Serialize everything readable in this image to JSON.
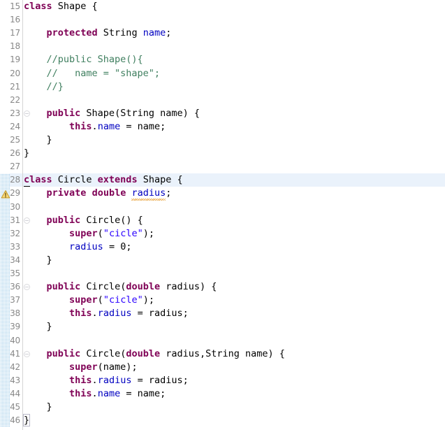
{
  "editor": {
    "app": "eclipse-java-editor",
    "language": "Java",
    "first_line_number": 15,
    "last_line_number": 46,
    "line_height_px": 19.1,
    "current_line_number": 28,
    "colors": {
      "background": "#ffffff",
      "keyword": "#7f0055",
      "string": "#2a00ff",
      "comment": "#3f7f5f",
      "field": "#0000c0",
      "plain": "#000000",
      "line_number": "#888888",
      "current_line_highlight": "#eaf2fb",
      "change_bar": "#9ecbe8",
      "warning_squiggle": "#e8a33d",
      "gutter_separator": "#d4d4d4"
    },
    "change_bar": {
      "from_line": 28,
      "to_line": 46
    },
    "fold_markers": [
      23,
      31,
      36,
      41
    ],
    "warning_markers": [
      {
        "line": 29,
        "icon": "warning-triangle-icon"
      }
    ]
  },
  "lines": [
    {
      "n": 15,
      "tokens": [
        {
          "t": "class",
          "c": "kw"
        },
        {
          "t": " Shape {",
          "c": "pl"
        }
      ]
    },
    {
      "n": 16,
      "tokens": []
    },
    {
      "n": 17,
      "tokens": [
        {
          "t": "    ",
          "c": "pl"
        },
        {
          "t": "protected",
          "c": "kw"
        },
        {
          "t": " String ",
          "c": "pl"
        },
        {
          "t": "name",
          "c": "fld"
        },
        {
          "t": ";",
          "c": "pl"
        }
      ]
    },
    {
      "n": 18,
      "tokens": []
    },
    {
      "n": 19,
      "tokens": [
        {
          "t": "    //public Shape(){",
          "c": "cmt"
        }
      ]
    },
    {
      "n": 20,
      "tokens": [
        {
          "t": "    //   name = \"shape\";",
          "c": "cmt"
        }
      ]
    },
    {
      "n": 21,
      "tokens": [
        {
          "t": "    //}",
          "c": "cmt"
        }
      ]
    },
    {
      "n": 22,
      "tokens": []
    },
    {
      "n": 23,
      "tokens": [
        {
          "t": "    ",
          "c": "pl"
        },
        {
          "t": "public",
          "c": "kw"
        },
        {
          "t": " Shape(String name) {",
          "c": "pl"
        }
      ]
    },
    {
      "n": 24,
      "tokens": [
        {
          "t": "        ",
          "c": "pl"
        },
        {
          "t": "this",
          "c": "kw"
        },
        {
          "t": ".",
          "c": "pl"
        },
        {
          "t": "name",
          "c": "fld"
        },
        {
          "t": " = name;",
          "c": "pl"
        }
      ]
    },
    {
      "n": 25,
      "tokens": [
        {
          "t": "    }",
          "c": "pl"
        }
      ]
    },
    {
      "n": 26,
      "tokens": [
        {
          "t": "}",
          "c": "pl"
        }
      ]
    },
    {
      "n": 27,
      "tokens": []
    },
    {
      "n": 28,
      "tokens": [
        {
          "t": "class",
          "c": "kw"
        },
        {
          "t": " Circle ",
          "c": "pl"
        },
        {
          "t": "extends",
          "c": "kw"
        },
        {
          "t": " Shape {",
          "c": "pl"
        }
      ]
    },
    {
      "n": 29,
      "tokens": [
        {
          "t": "    ",
          "c": "pl"
        },
        {
          "t": "private",
          "c": "kw"
        },
        {
          "t": " ",
          "c": "pl"
        },
        {
          "t": "double",
          "c": "kw"
        },
        {
          "t": " ",
          "c": "pl"
        },
        {
          "t": "radius",
          "c": "fld",
          "squiggle": true
        },
        {
          "t": ";",
          "c": "pl"
        }
      ]
    },
    {
      "n": 30,
      "tokens": []
    },
    {
      "n": 31,
      "tokens": [
        {
          "t": "    ",
          "c": "pl"
        },
        {
          "t": "public",
          "c": "kw"
        },
        {
          "t": " Circle() {",
          "c": "pl"
        }
      ]
    },
    {
      "n": 32,
      "tokens": [
        {
          "t": "        ",
          "c": "pl"
        },
        {
          "t": "super",
          "c": "kw"
        },
        {
          "t": "(",
          "c": "pl"
        },
        {
          "t": "\"cicle\"",
          "c": "str"
        },
        {
          "t": ");",
          "c": "pl"
        }
      ]
    },
    {
      "n": 33,
      "tokens": [
        {
          "t": "        ",
          "c": "pl"
        },
        {
          "t": "radius",
          "c": "fld"
        },
        {
          "t": " = ",
          "c": "pl"
        },
        {
          "t": "0",
          "c": "num"
        },
        {
          "t": ";",
          "c": "pl"
        }
      ]
    },
    {
      "n": 34,
      "tokens": [
        {
          "t": "    }",
          "c": "pl"
        }
      ]
    },
    {
      "n": 35,
      "tokens": []
    },
    {
      "n": 36,
      "tokens": [
        {
          "t": "    ",
          "c": "pl"
        },
        {
          "t": "public",
          "c": "kw"
        },
        {
          "t": " Circle(",
          "c": "pl"
        },
        {
          "t": "double",
          "c": "kw"
        },
        {
          "t": " radius) {",
          "c": "pl"
        }
      ]
    },
    {
      "n": 37,
      "tokens": [
        {
          "t": "        ",
          "c": "pl"
        },
        {
          "t": "super",
          "c": "kw"
        },
        {
          "t": "(",
          "c": "pl"
        },
        {
          "t": "\"cicle\"",
          "c": "str"
        },
        {
          "t": ");",
          "c": "pl"
        }
      ]
    },
    {
      "n": 38,
      "tokens": [
        {
          "t": "        ",
          "c": "pl"
        },
        {
          "t": "this",
          "c": "kw"
        },
        {
          "t": ".",
          "c": "pl"
        },
        {
          "t": "radius",
          "c": "fld"
        },
        {
          "t": " = radius;",
          "c": "pl"
        }
      ]
    },
    {
      "n": 39,
      "tokens": [
        {
          "t": "    }",
          "c": "pl"
        }
      ]
    },
    {
      "n": 40,
      "tokens": []
    },
    {
      "n": 41,
      "tokens": [
        {
          "t": "    ",
          "c": "pl"
        },
        {
          "t": "public",
          "c": "kw"
        },
        {
          "t": " Circle(",
          "c": "pl"
        },
        {
          "t": "double",
          "c": "kw"
        },
        {
          "t": " radius,String name) {",
          "c": "pl"
        }
      ]
    },
    {
      "n": 42,
      "tokens": [
        {
          "t": "        ",
          "c": "pl"
        },
        {
          "t": "super",
          "c": "kw"
        },
        {
          "t": "(name);",
          "c": "pl"
        }
      ]
    },
    {
      "n": 43,
      "tokens": [
        {
          "t": "        ",
          "c": "pl"
        },
        {
          "t": "this",
          "c": "kw"
        },
        {
          "t": ".",
          "c": "pl"
        },
        {
          "t": "radius",
          "c": "fld"
        },
        {
          "t": " = radius;",
          "c": "pl"
        }
      ]
    },
    {
      "n": 44,
      "tokens": [
        {
          "t": "        ",
          "c": "pl"
        },
        {
          "t": "this",
          "c": "kw"
        },
        {
          "t": ".",
          "c": "pl"
        },
        {
          "t": "name",
          "c": "fld"
        },
        {
          "t": " = name;",
          "c": "pl"
        }
      ]
    },
    {
      "n": 45,
      "tokens": [
        {
          "t": "    }",
          "c": "pl"
        }
      ]
    },
    {
      "n": 46,
      "tokens": [
        {
          "t": "}",
          "c": "pl",
          "brace_match": true
        }
      ]
    }
  ]
}
